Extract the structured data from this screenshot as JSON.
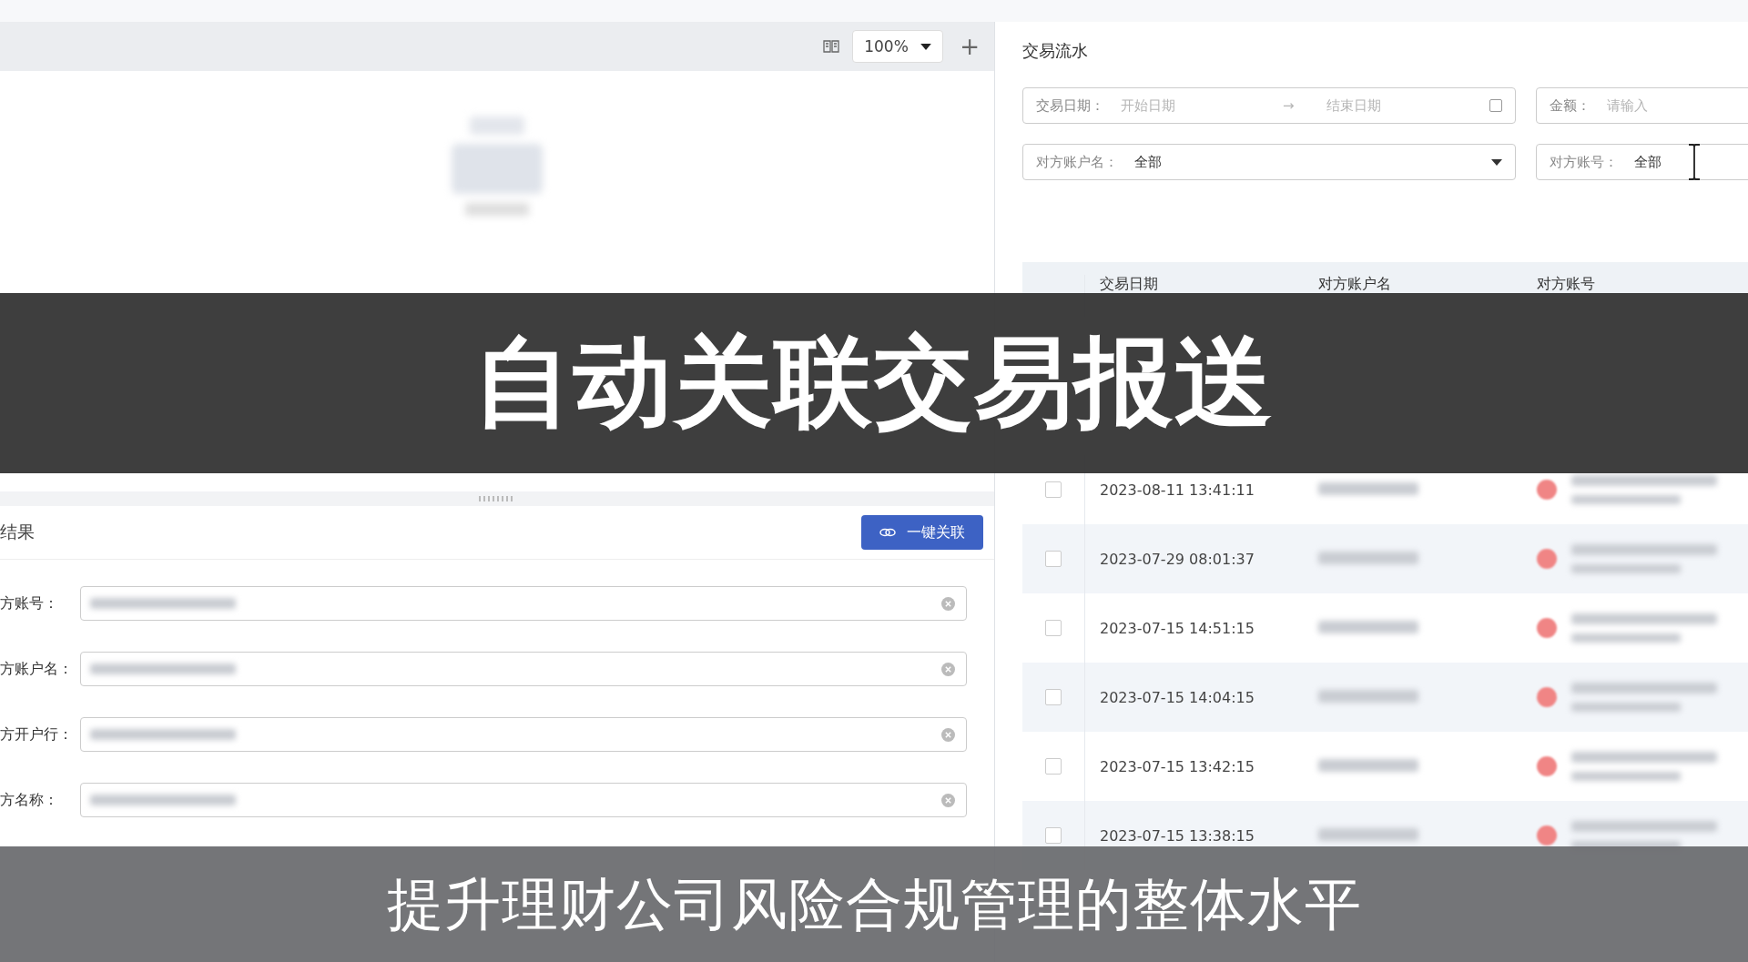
{
  "viewer_toolbar": {
    "zoom": "100%",
    "plus": "+"
  },
  "result_panel": {
    "title": "结果",
    "button": "一键关联",
    "fields": [
      {
        "label": "方账号："
      },
      {
        "label": "方账户名："
      },
      {
        "label": "方开户行："
      },
      {
        "label": "方名称："
      }
    ]
  },
  "transactions": {
    "title": "交易流水",
    "filters": [
      {
        "kind": "daterange",
        "label": "交易日期：",
        "start_placeholder": "开始日期",
        "arrow": "→",
        "end_placeholder": "结束日期"
      },
      {
        "kind": "input",
        "label": "金额：",
        "placeholder": "请输入"
      },
      {
        "kind": "select",
        "label": "对方账户名：",
        "value": "全部"
      },
      {
        "kind": "input",
        "label": "对方账号：",
        "value": "全部"
      }
    ],
    "table": {
      "columns": [
        "交易日期",
        "对方账户名",
        "对方账号"
      ],
      "rows": [
        {
          "date": "2023-08-11 13:41:11",
          "checked": false
        },
        {
          "date": "2023-07-29 08:01:37",
          "checked": false
        },
        {
          "date": "2023-07-15 14:51:15",
          "checked": false
        },
        {
          "date": "2023-07-15 14:04:15",
          "checked": false
        },
        {
          "date": "2023-07-15 13:42:15",
          "checked": false
        },
        {
          "date": "2023-07-15 13:38:15",
          "checked": false
        }
      ]
    }
  },
  "banner_title": "自动关联交易报送",
  "caption": "提升理财公司风险合规管理的整体水平"
}
